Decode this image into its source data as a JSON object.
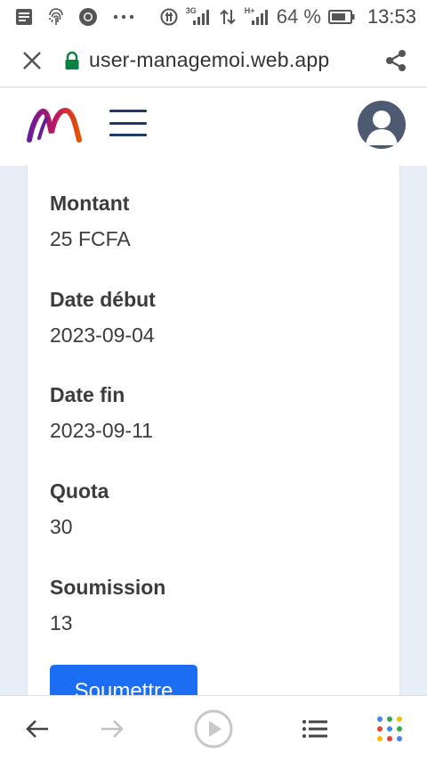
{
  "statusbar": {
    "icons": [
      "message-icon",
      "fingerprint-icon",
      "chrome-icon",
      "more-dots-icon",
      "data-saver-icon",
      "signal-3g-icon",
      "data-transfer-icon",
      "signal-hplus-icon",
      "battery-icon"
    ],
    "network_a": "3G",
    "network_b": "H+",
    "battery": "64 %",
    "time": "13:53"
  },
  "browser": {
    "url": "user-managemoi.web.app",
    "lock_color": "#0b8043"
  },
  "header": {
    "logo_colors": [
      "#6a1b9a",
      "#c2185b",
      "#e65100"
    ],
    "menu_color": "#1f3b68",
    "avatar_bg": "#4e5a72"
  },
  "details": {
    "montant_label": "Montant",
    "montant_value": "25 FCFA",
    "date_debut_label": "Date début",
    "date_debut_value": "2023-09-04",
    "date_fin_label": "Date fin",
    "date_fin_value": "2023-09-11",
    "quota_label": "Quota",
    "quota_value": "30",
    "soumission_label": "Soumission",
    "soumission_value": "13",
    "submit_label": "Soumettre",
    "submit_color": "#1b6ef3"
  },
  "bottomnav": {
    "items": [
      "back-arrow-icon",
      "forward-arrow-icon",
      "play-icon",
      "list-icon",
      "apps-grid-icon"
    ]
  }
}
